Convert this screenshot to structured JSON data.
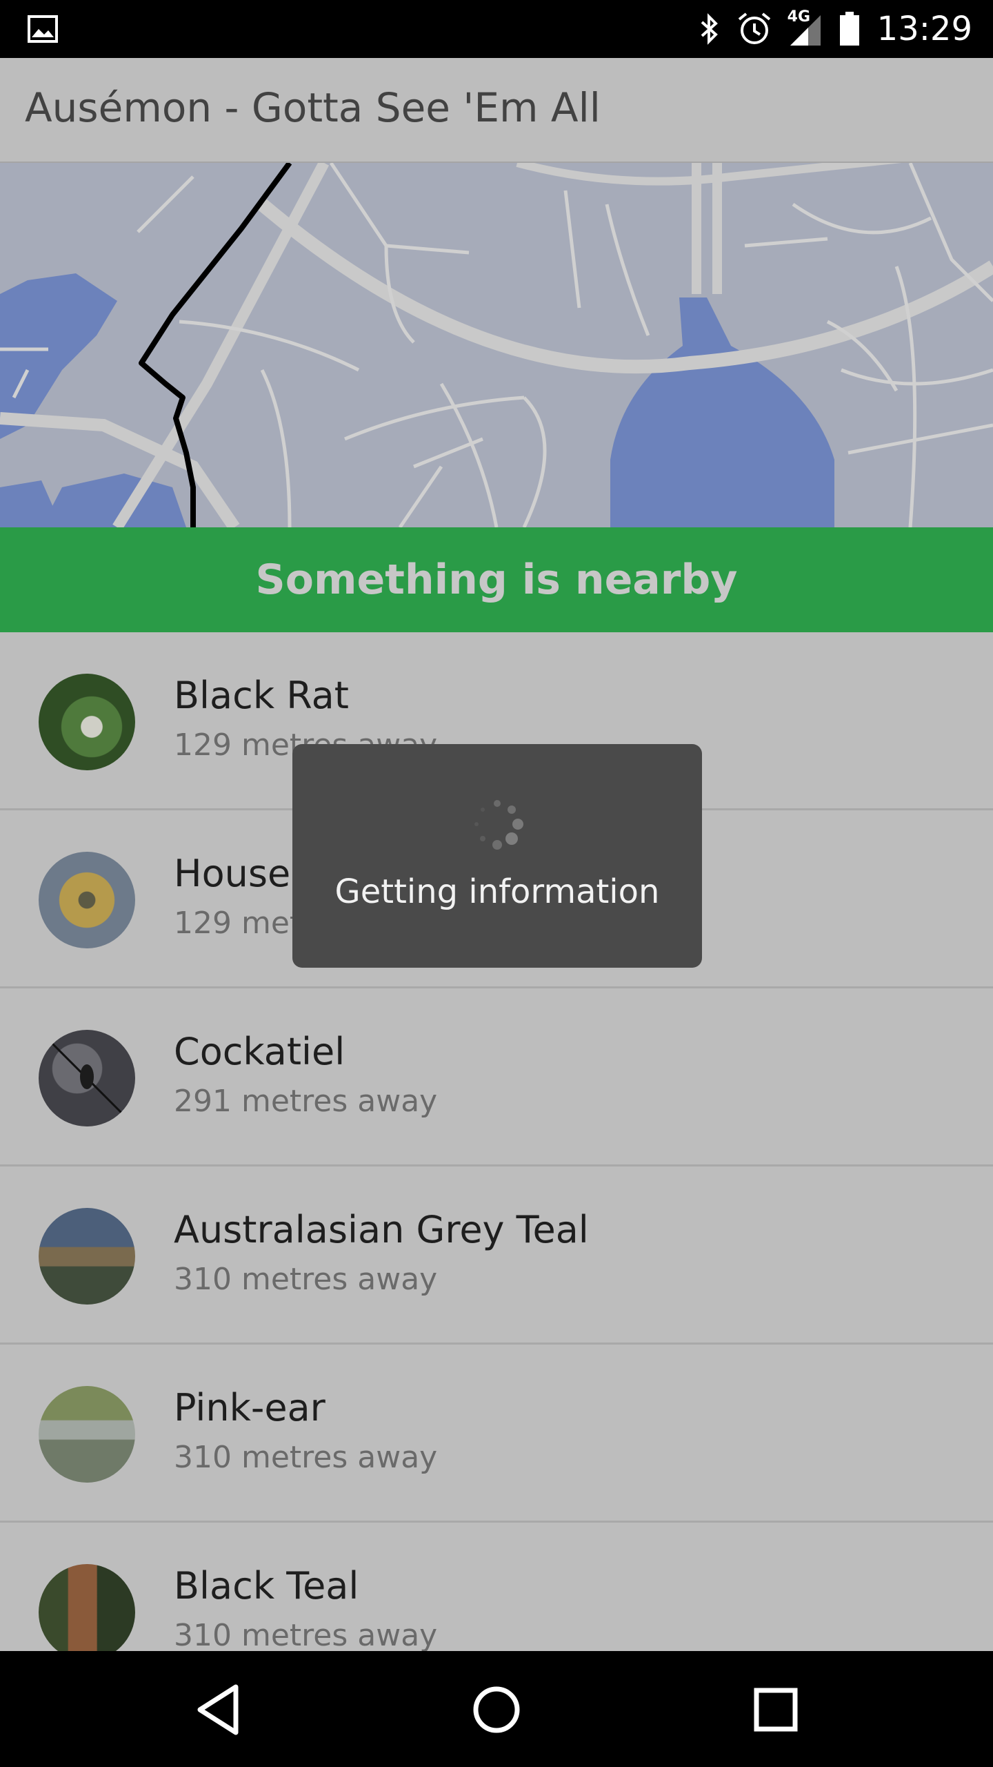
{
  "status_bar": {
    "time": "13:29",
    "network": "4G",
    "icons": [
      "image-icon",
      "bluetooth-icon",
      "alarm-icon",
      "signal-icon",
      "battery-icon"
    ]
  },
  "app_bar": {
    "title": "Ausémon - Gotta See 'Em All"
  },
  "banner": {
    "text": "Something is nearby",
    "color": "#2a9b47"
  },
  "items": [
    {
      "name": "Black Rat",
      "distance": "129 metres away"
    },
    {
      "name": "House Mouse",
      "distance": "129 metres away"
    },
    {
      "name": "Cockatiel",
      "distance": "291 metres away"
    },
    {
      "name": "Australasian Grey Teal",
      "distance": "310 metres away"
    },
    {
      "name": "Pink-ear",
      "distance": "310 metres away"
    },
    {
      "name": "Black Teal",
      "distance": "310 metres away"
    }
  ],
  "dialog": {
    "text": "Getting information"
  },
  "nav": {
    "icons": [
      "back-icon",
      "home-icon",
      "recents-icon"
    ]
  }
}
